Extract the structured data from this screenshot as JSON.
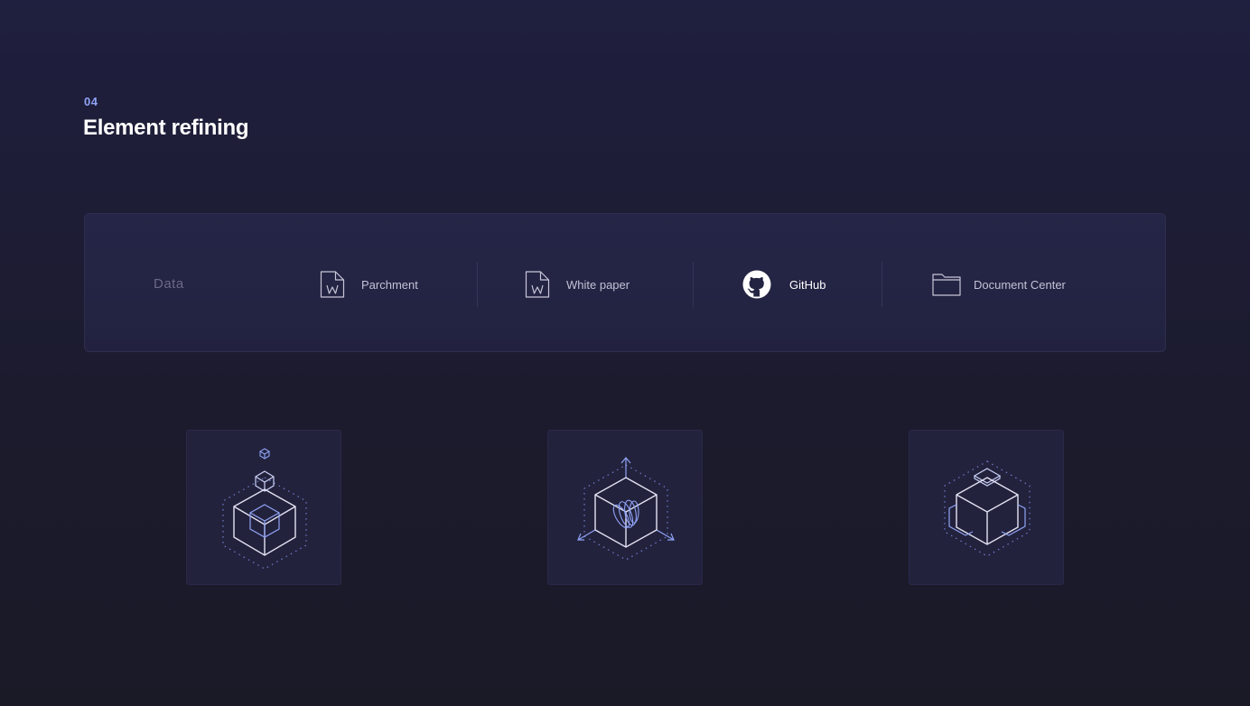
{
  "section": {
    "number": "04",
    "title": "Element refining"
  },
  "data_bar": {
    "label": "Data",
    "items": [
      {
        "label": "Parchment",
        "icon": "word-document-icon"
      },
      {
        "label": "White paper",
        "icon": "word-document-icon"
      },
      {
        "label": "GitHub",
        "icon": "github-icon"
      },
      {
        "label": "Document Center",
        "icon": "folder-icon"
      }
    ]
  },
  "illustrations": [
    {
      "icon": "cube-stack-icon"
    },
    {
      "icon": "cube-axes-icon"
    },
    {
      "icon": "cube-modules-icon"
    }
  ],
  "colors": {
    "background": "#1c1b2e",
    "card": "#23223d",
    "accent": "#8fa3f5",
    "line": "#e4e4f4",
    "muted_text": "#6c6a86"
  }
}
